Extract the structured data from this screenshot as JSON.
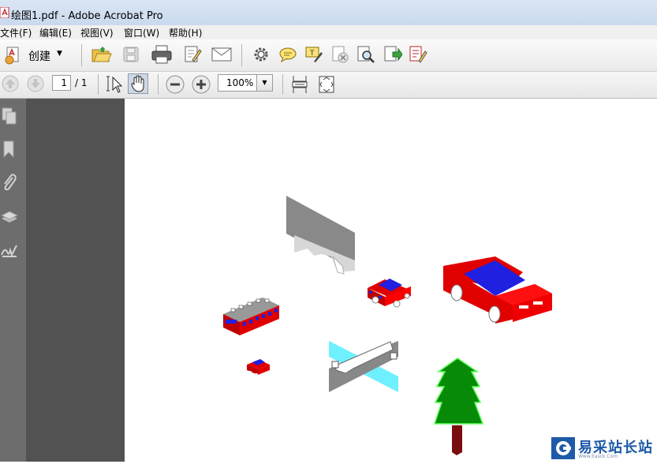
{
  "window": {
    "title": "绘图1.pdf - Adobe Acrobat Pro"
  },
  "menu": {
    "items": [
      "文件(F)",
      "编辑(E)",
      "视图(V)",
      "窗口(W)",
      "帮助(H)"
    ]
  },
  "toolbar": {
    "create_label": "创建",
    "icons": [
      "open-folder",
      "save",
      "print",
      "edit-document",
      "email",
      "settings",
      "comment",
      "highlight",
      "delete-pages",
      "search-pages",
      "export",
      "sign-document"
    ]
  },
  "navigation": {
    "page_current": "1",
    "page_total": "/ 1",
    "zoom": "100%"
  },
  "left_panel": {
    "icons": [
      "pages-icon",
      "bookmark-icon",
      "attachment-icon",
      "layers-icon",
      "signature-icon"
    ]
  },
  "watermark": {
    "text": "易采站长站",
    "sub": "Www.Easck.Com"
  },
  "colors": {
    "titlebar": "#c9d9ee",
    "panel": "#6d6d6d",
    "gutter": "#525252",
    "accent": "#1e5aa8"
  }
}
